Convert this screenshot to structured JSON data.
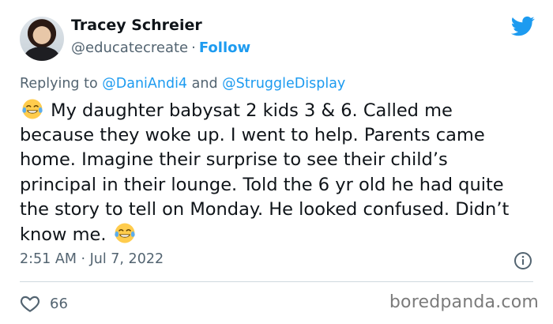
{
  "author": {
    "name": "Tracey Schreier",
    "handle": "@educatecreate",
    "separator": "·",
    "follow_label": "Follow"
  },
  "reply": {
    "prefix": "Replying to",
    "mention_1": "@DaniAndi4",
    "conjunction": "and",
    "mention_2": "@StruggleDisplay"
  },
  "tweet": {
    "text": "My daughter babysat 2 kids 3 & 6. Called me because they woke up. I went to help. Parents came home. Imagine their surprise to see their child’s principal in their lounge. Told the 6 yr old he had quite the story to tell on Monday. He looked confused. Didn’t know me.",
    "lead_emoji": "face-with-tears-of-joy",
    "trail_emoji": "face-with-tears-of-joy"
  },
  "meta": {
    "timestamp": "2:51 AM · Jul 7, 2022"
  },
  "engagement": {
    "like_count": "66"
  },
  "watermark": "boredpanda.com",
  "colors": {
    "accent": "#1d9bf0",
    "secondary_text": "#536471",
    "primary_text": "#0f1419"
  },
  "icons": {
    "logo": "twitter-bird-icon",
    "info": "info-icon",
    "like": "heart-icon",
    "emoji": "tears-of-joy-emoji-icon"
  }
}
